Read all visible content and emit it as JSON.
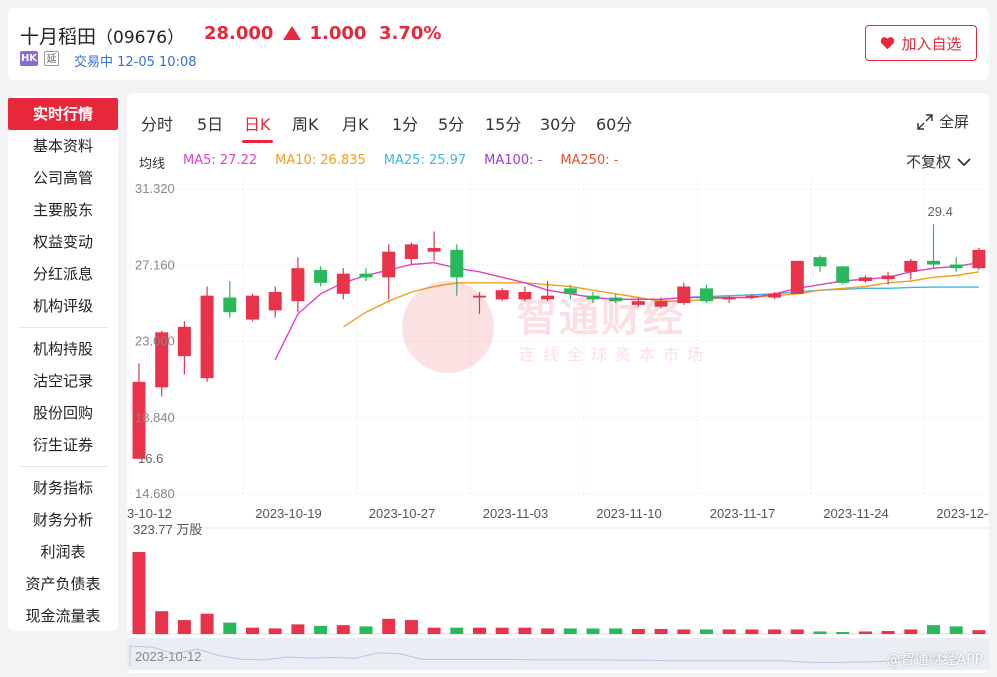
{
  "stock": {
    "name": "十月稻田",
    "code": "（09676）",
    "price": "28.000",
    "change": "1.000",
    "change_pct": "3.70%",
    "market_badge": "HK",
    "delay_badge": "延",
    "status": "交易中 12-05 10:08",
    "add_watch": "加入自选"
  },
  "sidebar": {
    "items": [
      "实时行情",
      "基本资料",
      "公司高管",
      "主要股东",
      "权益变动",
      "分红派息",
      "机构评级",
      "机构持股",
      "沽空记录",
      "股份回购",
      "衍生证券",
      "财务指标",
      "财务分析",
      "利润表",
      "资产负债表",
      "现金流量表"
    ]
  },
  "tabs": [
    "分时",
    "5日",
    "日K",
    "周K",
    "月K",
    "1分",
    "5分",
    "15分",
    "30分",
    "60分"
  ],
  "toolbar": {
    "fullscreen": "全屏",
    "adjust": "不复权"
  },
  "ma_legend": {
    "label": "均线",
    "ma5": "MA5: 27.22",
    "ma10": "MA10: 26.835",
    "ma25": "MA25: 25.97",
    "ma100": "MA100: -",
    "ma250": "MA250: -"
  },
  "colors": {
    "up": "#e8334b",
    "down": "#29b95a",
    "ma5": "#e040c8",
    "ma10": "#f0a020",
    "ma25": "#3fb6e8",
    "ma100": "#9b3fd6",
    "ma250": "#e8502a"
  },
  "watermark": {
    "brand": "智通财经",
    "slogan": "连线全球资本市场",
    "footer": "@智通财经APP"
  },
  "chart_data": {
    "type": "candlestick",
    "y_ticks": [
      "31.320",
      "27.160",
      "23.000",
      "18.840",
      "14.680"
    ],
    "ylim": [
      14.68,
      31.32
    ],
    "x_ticks": [
      "3-10-12",
      "2023-10-19",
      "2023-10-27",
      "2023-11-03",
      "2023-11-10",
      "2023-11-17",
      "2023-11-24",
      "2023-12-01"
    ],
    "annotations": {
      "high": "29.4",
      "low": "16.6"
    },
    "volume_label": "323.77 万股",
    "navigator_label": "2023-10-12",
    "candles": [
      {
        "o": 16.6,
        "c": 20.8,
        "h": 21.8,
        "l": 16.6
      },
      {
        "o": 20.5,
        "c": 23.5,
        "h": 23.6,
        "l": 20.0
      },
      {
        "o": 22.2,
        "c": 23.8,
        "h": 24.1,
        "l": 21.2
      },
      {
        "o": 21.0,
        "c": 25.5,
        "h": 26.0,
        "l": 20.8
      },
      {
        "o": 25.4,
        "c": 24.6,
        "h": 26.3,
        "l": 24.3
      },
      {
        "o": 24.2,
        "c": 25.5,
        "h": 25.6,
        "l": 24.1
      },
      {
        "o": 24.7,
        "c": 25.7,
        "h": 26.0,
        "l": 24.3
      },
      {
        "o": 25.2,
        "c": 27.0,
        "h": 27.6,
        "l": 24.6
      },
      {
        "o": 26.9,
        "c": 26.2,
        "h": 27.1,
        "l": 26.0
      },
      {
        "o": 25.6,
        "c": 26.7,
        "h": 27.0,
        "l": 25.3
      },
      {
        "o": 26.7,
        "c": 26.5,
        "h": 27.0,
        "l": 26.3
      },
      {
        "o": 26.5,
        "c": 27.9,
        "h": 28.3,
        "l": 25.3
      },
      {
        "o": 27.5,
        "c": 28.3,
        "h": 28.4,
        "l": 27.2
      },
      {
        "o": 27.9,
        "c": 28.1,
        "h": 29.0,
        "l": 27.4
      },
      {
        "o": 28.0,
        "c": 26.5,
        "h": 28.3,
        "l": 25.5
      },
      {
        "o": 25.4,
        "c": 25.5,
        "h": 25.7,
        "l": 24.5
      },
      {
        "o": 25.3,
        "c": 25.8,
        "h": 25.9,
        "l": 25.2
      },
      {
        "o": 25.3,
        "c": 25.7,
        "h": 26.0,
        "l": 25.2
      },
      {
        "o": 25.3,
        "c": 25.5,
        "h": 26.3,
        "l": 25.2
      },
      {
        "o": 25.9,
        "c": 25.6,
        "h": 26.1,
        "l": 25.3
      },
      {
        "o": 25.5,
        "c": 25.3,
        "h": 25.7,
        "l": 25.1
      },
      {
        "o": 25.4,
        "c": 25.2,
        "h": 25.6,
        "l": 25.1
      },
      {
        "o": 25.0,
        "c": 25.2,
        "h": 25.4,
        "l": 24.9
      },
      {
        "o": 24.9,
        "c": 25.2,
        "h": 25.4,
        "l": 24.8
      },
      {
        "o": 25.1,
        "c": 26.0,
        "h": 26.2,
        "l": 25.0
      },
      {
        "o": 25.9,
        "c": 25.2,
        "h": 26.1,
        "l": 25.1
      },
      {
        "o": 25.3,
        "c": 25.4,
        "h": 25.5,
        "l": 25.1
      },
      {
        "o": 25.4,
        "c": 25.5,
        "h": 25.6,
        "l": 25.3
      },
      {
        "o": 25.4,
        "c": 25.6,
        "h": 25.7,
        "l": 25.3
      },
      {
        "o": 25.6,
        "c": 27.4,
        "h": 27.4,
        "l": 25.6
      },
      {
        "o": 27.6,
        "c": 27.1,
        "h": 27.7,
        "l": 26.8
      },
      {
        "o": 27.1,
        "c": 26.2,
        "h": 27.1,
        "l": 26.1
      },
      {
        "o": 26.3,
        "c": 26.5,
        "h": 26.6,
        "l": 26.2
      },
      {
        "o": 26.4,
        "c": 26.6,
        "h": 26.8,
        "l": 26.1
      },
      {
        "o": 26.8,
        "c": 27.4,
        "h": 27.5,
        "l": 26.4
      },
      {
        "o": 27.4,
        "c": 27.2,
        "h": 29.4,
        "l": 27.0
      },
      {
        "o": 27.2,
        "c": 27.0,
        "h": 27.6,
        "l": 26.8
      },
      {
        "o": 27.0,
        "c": 28.0,
        "h": 28.1,
        "l": 26.9
      }
    ],
    "volumes": [
      323.77,
      90,
      55,
      80,
      45,
      25,
      22,
      38,
      32,
      35,
      30,
      60,
      55,
      25,
      25,
      25,
      25,
      25,
      22,
      22,
      22,
      22,
      20,
      20,
      18,
      18,
      18,
      18,
      18,
      18,
      10,
      8,
      10,
      12,
      18,
      35,
      30,
      15
    ],
    "ma5": [
      null,
      null,
      null,
      null,
      null,
      null,
      22.0,
      24.5,
      25.6,
      26.2,
      26.6,
      26.9,
      27.2,
      27.3,
      27.0,
      26.8,
      26.5,
      26.2,
      25.8,
      25.6,
      25.4,
      25.3,
      25.3,
      25.3,
      25.4,
      25.4,
      25.4,
      25.4,
      25.6,
      25.9,
      26.1,
      26.3,
      26.4,
      26.5,
      26.8,
      27.0,
      27.1,
      27.3
    ],
    "ma10": [
      null,
      null,
      null,
      null,
      null,
      null,
      null,
      null,
      null,
      23.8,
      24.6,
      25.2,
      25.7,
      26.0,
      26.2,
      26.2,
      26.2,
      26.2,
      26.1,
      26.0,
      25.8,
      25.6,
      25.4,
      25.2,
      25.2,
      25.3,
      25.4,
      25.4,
      25.5,
      25.6,
      25.8,
      25.9,
      26.0,
      26.2,
      26.3,
      26.5,
      26.6,
      26.8
    ],
    "ma25": [
      null,
      null,
      null,
      null,
      null,
      null,
      null,
      null,
      null,
      null,
      null,
      null,
      null,
      null,
      null,
      null,
      null,
      null,
      null,
      null,
      null,
      null,
      null,
      null,
      25.4,
      25.45,
      25.5,
      25.55,
      25.6,
      25.7,
      25.8,
      25.85,
      25.9,
      25.9,
      25.95,
      25.97,
      25.97,
      25.97
    ]
  }
}
